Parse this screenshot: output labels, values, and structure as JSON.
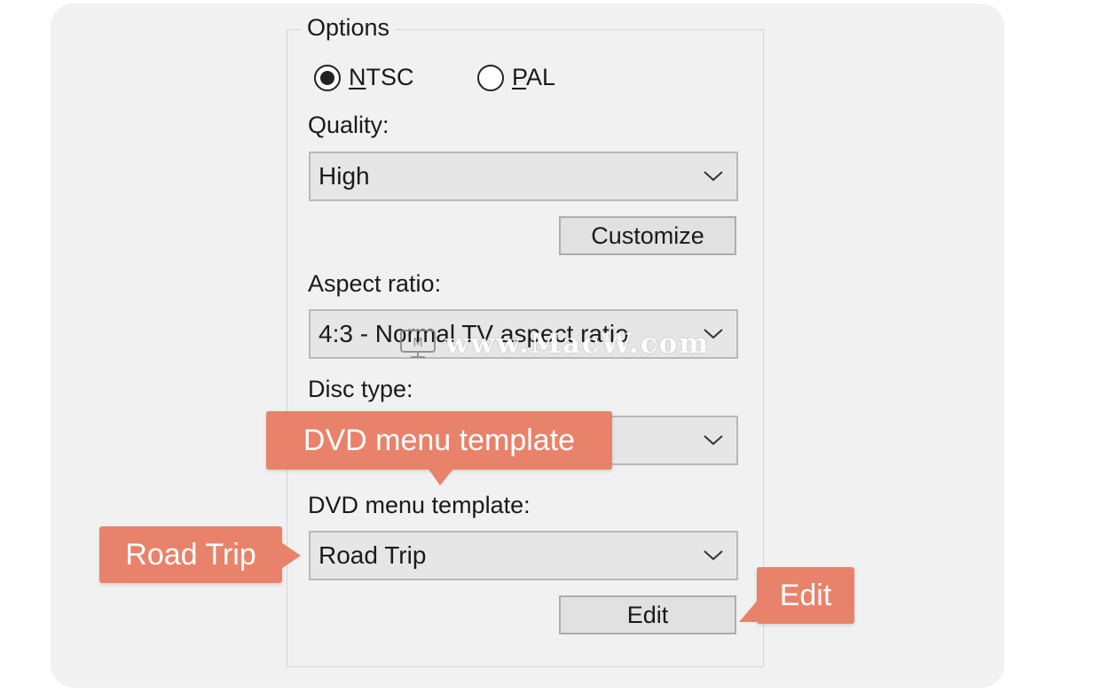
{
  "options_group": {
    "legend": "Options",
    "video_standard": {
      "ntsc_label_underlined": "N",
      "ntsc_label_rest": "TSC",
      "pal_label_underlined": "P",
      "pal_label_rest": "AL",
      "selected": "NTSC"
    },
    "quality": {
      "label": "Quality:",
      "value": "High"
    },
    "customize_button": "Customize",
    "aspect_ratio": {
      "label": "Aspect ratio:",
      "value": "4:3 - Normal TV aspect ratio"
    },
    "disc_type": {
      "label": "Disc type:",
      "value": ""
    },
    "dvd_menu_template": {
      "label": "DVD menu template:",
      "value": "Road Trip"
    },
    "edit_button": "Edit"
  },
  "callouts": {
    "dvd_menu_template": "DVD menu template",
    "road_trip": "Road Trip",
    "edit": "Edit"
  },
  "watermark": {
    "text": "www.MacW.com"
  },
  "colors": {
    "callout": "#e9826a",
    "card_background": "#f1f1f1",
    "control_background": "#e6e6e6"
  },
  "icons": {
    "dropdown": "chevron-down-icon",
    "radio_selected": "radio-selected-icon",
    "radio_unselected": "radio-unselected-icon"
  }
}
